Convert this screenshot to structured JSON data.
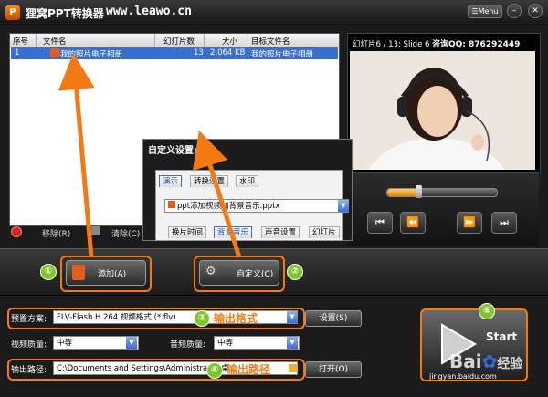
{
  "window": {
    "app_title": "狸窝PPT转换器",
    "site": "www.leawo.cn",
    "menu_label": "Menu",
    "minimize_glyph": "–",
    "close_glyph": "✕"
  },
  "table": {
    "headers": [
      "序号",
      "文件名",
      "幻灯片数",
      "大小",
      "目标文件名"
    ],
    "rows": [
      {
        "index": "1",
        "filename": "我的照片电子相册",
        "slides": "13",
        "size": "2,064 KB",
        "target": "我的照片电子相册"
      }
    ]
  },
  "list_actions": {
    "remove_label": "移除(R)",
    "clear_label": "清除(C)"
  },
  "preview": {
    "slide_info": "幻灯片6 / 13: Slide 6",
    "qq_info": "咨询QQ: 876292449"
  },
  "player": {
    "progress": 0.3,
    "buttons": [
      "⏮",
      "⏪",
      "⏩",
      "⏭"
    ]
  },
  "actions": {
    "add_label": "添加(A)",
    "custom_label": "自定义(C)"
  },
  "dialog": {
    "title": "自定义设置:",
    "top_tabs": [
      "演示",
      "转换设置",
      "水印"
    ],
    "file_select": "ppt添加视频加背景音乐.pptx",
    "sub_tabs": [
      "换片时间",
      "背景音乐",
      "声音设置",
      "幻灯片"
    ]
  },
  "form": {
    "preset_label": "预置方案:",
    "preset_value": "FLV-Flash H.264 视频格式 (*.flv)",
    "settings_button": "设置(S)",
    "video_quality_label": "视频质量:",
    "video_quality_value": "中等",
    "audio_quality_label": "音频质量:",
    "audio_quality_value": "中等",
    "output_label": "输出路径:",
    "output_value": "C:\\Documents and Settings\\Administrator\\桌",
    "open_button": "打开(O)"
  },
  "annotations": {
    "numbers": [
      "①",
      "②",
      "③",
      "④",
      "⑤"
    ],
    "output_format": "输出格式",
    "output_path": "输出路径"
  },
  "start": {
    "label": "Start"
  },
  "watermark": {
    "brand": "Bai",
    "brand_cn": "经验",
    "url": "jingyan.baidu.com"
  },
  "colors": {
    "accent_orange": "#f37a12",
    "selection_blue": "#3a6ed1",
    "badge_green": "#7ec62a"
  }
}
